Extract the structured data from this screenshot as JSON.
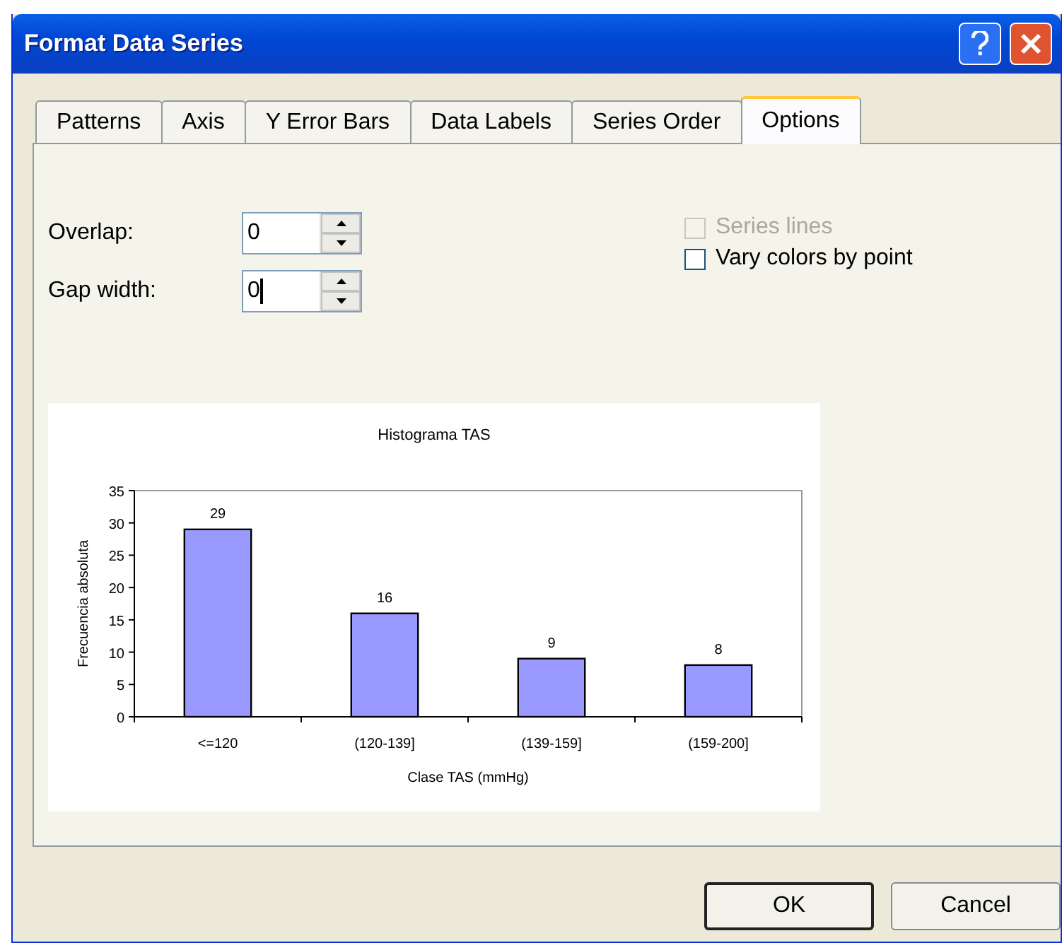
{
  "window": {
    "title": "Format Data Series"
  },
  "tabs": [
    {
      "label": "Patterns",
      "selected": false
    },
    {
      "label": "Axis",
      "selected": false
    },
    {
      "label": "Y Error Bars",
      "selected": false
    },
    {
      "label": "Data Labels",
      "selected": false
    },
    {
      "label": "Series Order",
      "selected": false
    },
    {
      "label": "Options",
      "selected": true
    }
  ],
  "fields": [
    {
      "label": "Overlap:",
      "value": "0",
      "focused": false
    },
    {
      "label": "Gap width:",
      "value": "0",
      "focused": true
    }
  ],
  "checkboxes": [
    {
      "label": "Series lines",
      "checked": false,
      "disabled": true
    },
    {
      "label": "Vary colors by point",
      "checked": false,
      "disabled": false
    }
  ],
  "preview": {
    "chart_data": {
      "type": "bar",
      "title": "Histograma TAS",
      "xlabel": "Clase TAS (mmHg)",
      "ylabel": "Frecuencia absoluta",
      "categories": [
        "<=120",
        "(120-139]",
        "(139-159]",
        "(159-200]"
      ],
      "values": [
        29,
        16,
        9,
        8
      ],
      "ylim": [
        0,
        35
      ],
      "yticks": [
        0,
        5,
        10,
        15,
        20,
        25,
        30,
        35
      ],
      "data_labels": true
    }
  },
  "buttons": [
    {
      "label": "OK",
      "default": true
    },
    {
      "label": "Cancel",
      "default": false
    }
  ]
}
